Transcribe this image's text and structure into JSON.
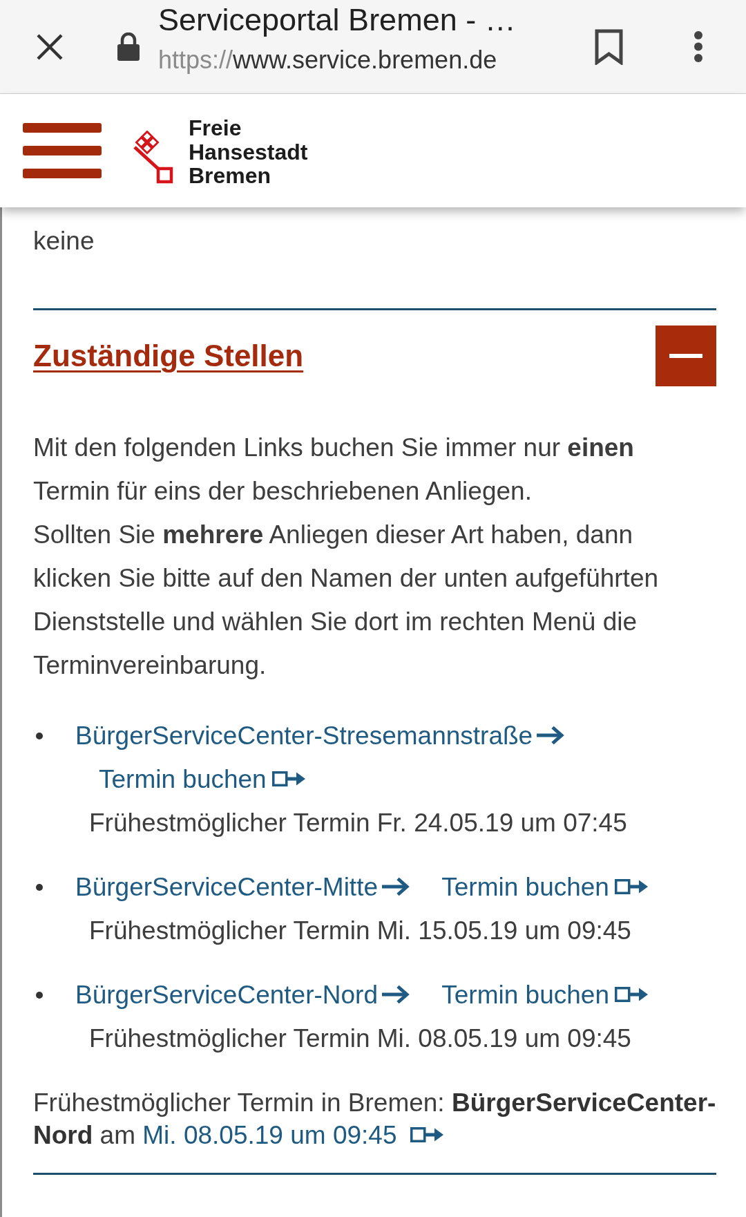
{
  "browser_bar": {
    "title": "Serviceportal Bremen - …",
    "url": {
      "scheme": "https://",
      "host": "www.service.bremen.de"
    }
  },
  "site_header": {
    "logo_text": "Freie Hansestadt Bremen"
  },
  "previous_section": {
    "text": "keine"
  },
  "section": {
    "title": "Zuständige Stellen",
    "expanded": true,
    "paragraphs": [
      "Mit den folgenden Links buchen Sie immer nur **einen** Termin für eins der beschriebenen Anliegen.",
      "Sollten Sie **mehrere** Anliegen dieser Art haben, dann klicken Sie bitte auf den Namen der unten aufgeführten Dienststelle und wählen Sie dort im rechten Menü die Terminvereinbarung."
    ],
    "locations": [
      {
        "name": "BürgerServiceCenter-Stresemannstraße",
        "booking_link": "Termin buchen",
        "earliest": "Frühestmöglicher Termin Fr. 24.05.19 um 07:45"
      },
      {
        "name": "BürgerServiceCenter-Mitte",
        "booking_link": "Termin buchen",
        "earliest": "Frühestmöglicher Termin Mi. 15.05.19 um 09:45"
      },
      {
        "name": "BürgerServiceCenter-Nord",
        "booking_link": "Termin buchen",
        "earliest": "Frühestmöglicher Termin Mi. 08.05.19 um 09:45"
      }
    ],
    "summary": {
      "text": "Frühestmöglicher Termin in Bremen: **BürgerServiceCenter-Nord** am",
      "link": "Mi. 08.05.19 um 09:45"
    }
  }
}
